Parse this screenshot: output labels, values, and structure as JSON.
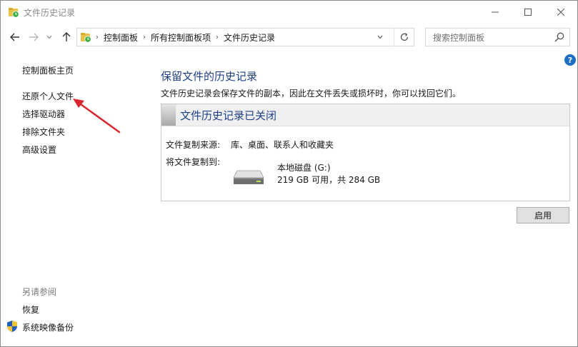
{
  "window": {
    "title": "文件历史记录"
  },
  "address": {
    "crumbs": [
      "控制面板",
      "所有控制面板项",
      "文件历史记录"
    ]
  },
  "search": {
    "placeholder": "搜索控制面板"
  },
  "sidebar": {
    "home": "控制面板主页",
    "links": [
      "还原个人文件",
      "选择驱动器",
      "排除文件夹",
      "高级设置"
    ],
    "see_also_title": "另请参阅",
    "see_also": [
      "恢复",
      "系统映像备份"
    ]
  },
  "main": {
    "heading": "保留文件的历史记录",
    "description": "文件历史记录会保存文件的副本，因此在文件丢失或损坏时，你可以找回它们。",
    "status_title": "文件历史记录已关闭",
    "source_label": "文件复制来源:",
    "source_value": "库、桌面、联系人和收藏夹",
    "dest_label": "将文件复制到:",
    "drive_name": "本地磁盘 (G:)",
    "drive_size": "219 GB 可用，共 284 GB",
    "enable_button": "启用"
  },
  "icons": {
    "app": "file-history-icon",
    "help": "help-icon",
    "shield": "uac-shield-icon",
    "drive": "hard-drive-icon"
  },
  "colors": {
    "heading": "#1e3f8a",
    "annotation_arrow": "#d9262e",
    "help_badge": "#1d6fc4"
  }
}
